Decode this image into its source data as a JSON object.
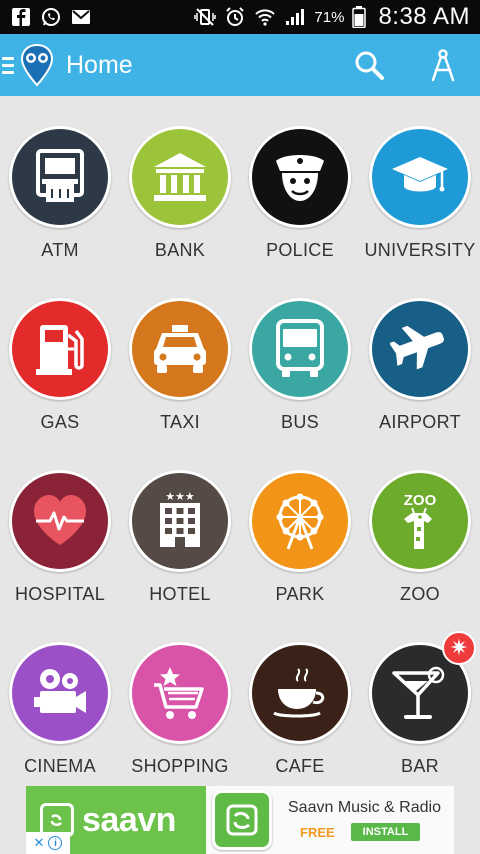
{
  "status_bar": {
    "battery_percent": "71%",
    "time": "8:38 AM"
  },
  "app_bar": {
    "title": "Home",
    "color": "#3fb3e6"
  },
  "categories": [
    {
      "label": "ATM",
      "color": "#2d3947",
      "icon": "atm-icon"
    },
    {
      "label": "BANK",
      "color": "#9bc43a",
      "icon": "bank-icon"
    },
    {
      "label": "POLICE",
      "color": "#111111",
      "icon": "police-icon"
    },
    {
      "label": "UNIVERSITY",
      "color": "#1e9bd6",
      "icon": "graduation-cap-icon"
    },
    {
      "label": "GAS",
      "color": "#e32b2b",
      "icon": "gas-pump-icon"
    },
    {
      "label": "TAXI",
      "color": "#d5771c",
      "icon": "taxi-icon"
    },
    {
      "label": "BUS",
      "color": "#3aa7a3",
      "icon": "bus-icon"
    },
    {
      "label": "AIRPORT",
      "color": "#175f87",
      "icon": "airplane-icon"
    },
    {
      "label": "HOSPITAL",
      "color": "#8a2338",
      "icon": "heart-pulse-icon"
    },
    {
      "label": "HOTEL",
      "color": "#554a45",
      "icon": "hotel-icon"
    },
    {
      "label": "PARK",
      "color": "#f29417",
      "icon": "ferris-wheel-icon"
    },
    {
      "label": "ZOO",
      "color": "#6dab2c",
      "icon": "giraffe-icon"
    },
    {
      "label": "CINEMA",
      "color": "#9b50c8",
      "icon": "movie-camera-icon"
    },
    {
      "label": "SHOPPING",
      "color": "#d953a8",
      "icon": "shopping-cart-icon"
    },
    {
      "label": "CAFE",
      "color": "#3a2218",
      "icon": "coffee-cup-icon"
    },
    {
      "label": "BAR",
      "color": "#2b2b2b",
      "icon": "cocktail-icon"
    }
  ],
  "zoo_icon_text": "ZOO",
  "bar_badge_glyph": "✷",
  "ad": {
    "brand_text": "saavn",
    "title": "Saavn Music & Radio",
    "price": "FREE",
    "install_label": "INSTALL",
    "info_glyph": "i",
    "close_glyph": "✕"
  }
}
